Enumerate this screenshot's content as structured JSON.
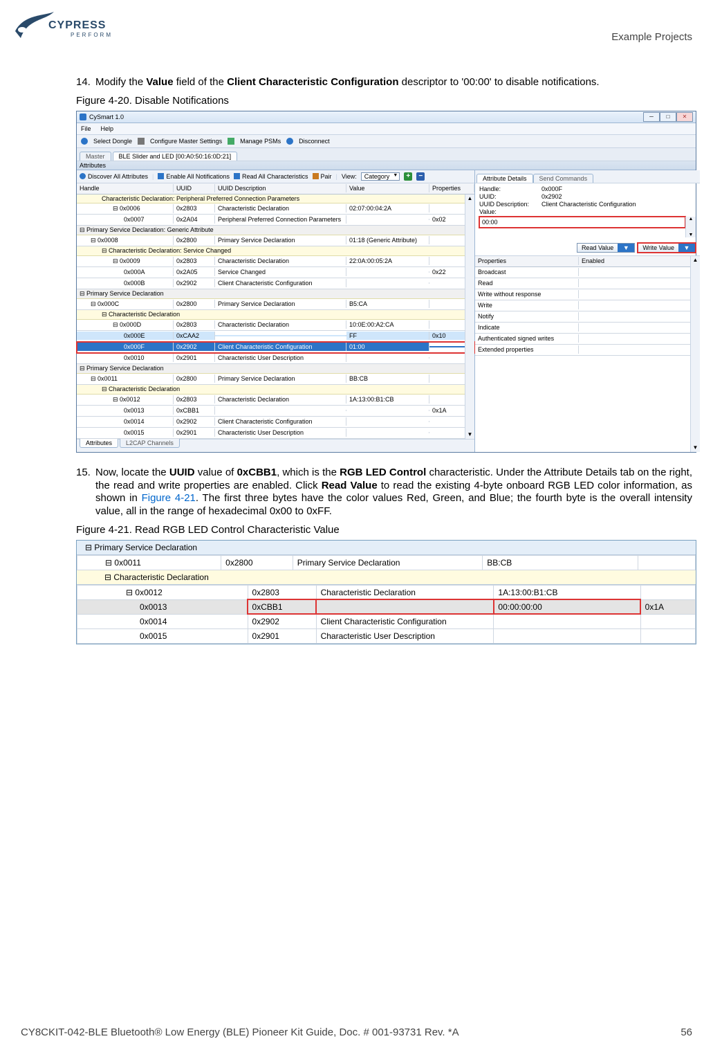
{
  "header": {
    "logo_main": "CYPRESS",
    "logo_sub": "PERFORM",
    "right": "Example Projects"
  },
  "step14": {
    "num": "14.",
    "text_pre": "Modify the ",
    "b1": "Value",
    "text_mid1": " field of the ",
    "b2": "Client Characteristic Configuration",
    "text_post": " descriptor to '00:00' to disable notifications."
  },
  "fig20": {
    "caption": "Figure 4-20.  Disable Notifications",
    "title": "CySmart 1.0",
    "menu": {
      "file": "File",
      "help": "Help"
    },
    "toolbar1": {
      "select_dongle": "Select Dongle",
      "configure": "Configure Master Settings",
      "manage": "Manage PSMs",
      "disconnect": "Disconnect"
    },
    "master_tab": "Master",
    "device_tab": "BLE Slider and LED [00:A0:50:16:0D:21]",
    "attributes_hdr": "Attributes",
    "toolbar2": {
      "discover": "Discover All Attributes",
      "enable": "Enable All Notifications",
      "read": "Read All Characteristics",
      "pair": "Pair",
      "view": "View:",
      "view_val": "Category"
    },
    "grid_headers": {
      "h1": "Handle",
      "h2": "UUID",
      "h3": "UUID Description",
      "h4": "Value",
      "h5": "Properties"
    },
    "groups": {
      "g_cd_ppcp": "Characteristic Declaration: Peripheral Preferred Connection Parameters",
      "g_psd_ga": "Primary Service Declaration: Generic Attribute",
      "g_cd_sc": "Characteristic Declaration: Service Changed",
      "g_psd": "Primary Service Declaration",
      "g_cd": "Characteristic Declaration"
    },
    "rows": [
      {
        "h": "0x0006",
        "u": "0x2803",
        "d": "Characteristic Declaration",
        "v": "02:07:00:04:2A",
        "p": ""
      },
      {
        "h": "0x0007",
        "u": "0x2A04",
        "d": "Peripheral Preferred Connection Parameters",
        "v": "",
        "p": "0x02"
      },
      {
        "h": "0x0008",
        "u": "0x2800",
        "d": "Primary Service Declaration",
        "v": "01:18 (Generic Attribute)",
        "p": ""
      },
      {
        "h": "0x0009",
        "u": "0x2803",
        "d": "Characteristic Declaration",
        "v": "22:0A:00:05:2A",
        "p": ""
      },
      {
        "h": "0x000A",
        "u": "0x2A05",
        "d": "Service Changed",
        "v": "",
        "p": "0x22"
      },
      {
        "h": "0x000B",
        "u": "0x2902",
        "d": "Client Characteristic Configuration",
        "v": "",
        "p": ""
      },
      {
        "h": "0x000C",
        "u": "0x2800",
        "d": "Primary Service Declaration",
        "v": "B5:CA",
        "p": ""
      },
      {
        "h": "0x000D",
        "u": "0x2803",
        "d": "Characteristic Declaration",
        "v": "10:0E:00:A2:CA",
        "p": ""
      },
      {
        "h": "0x000E",
        "u": "0xCAA2",
        "d": "",
        "v": "FF",
        "p": "0x10"
      },
      {
        "h": "0x000F",
        "u": "0x2902",
        "d": "Client Characteristic Configuration",
        "v": "01:00",
        "p": ""
      },
      {
        "h": "0x0010",
        "u": "0x2901",
        "d": "Characteristic User Description",
        "v": "",
        "p": ""
      },
      {
        "h": "0x0011",
        "u": "0x2800",
        "d": "Primary Service Declaration",
        "v": "BB:CB",
        "p": ""
      },
      {
        "h": "0x0012",
        "u": "0x2803",
        "d": "Characteristic Declaration",
        "v": "1A:13:00:B1:CB",
        "p": ""
      },
      {
        "h": "0x0013",
        "u": "0xCBB1",
        "d": "",
        "v": "",
        "p": "0x1A"
      },
      {
        "h": "0x0014",
        "u": "0x2902",
        "d": "Client Characteristic Configuration",
        "v": "",
        "p": ""
      },
      {
        "h": "0x0015",
        "u": "0x2901",
        "d": "Characteristic User Description",
        "v": "",
        "p": ""
      }
    ],
    "bottom_tabs": {
      "attributes": "Attributes",
      "l2cap": "L2CAP Channels"
    },
    "right": {
      "tab_details": "Attribute Details",
      "tab_send": "Send Commands",
      "handle_l": "Handle:",
      "handle_v": "0x000F",
      "uuid_l": "UUID:",
      "uuid_v": "0x2902",
      "uuiddesc_l": "UUID Description:",
      "uuiddesc_v": "Client Characteristic Configuration",
      "value_l": "Value:",
      "value_input": "00:00",
      "read_btn": "Read Value",
      "write_btn": "Write Value",
      "prop_h1": "Properties",
      "prop_h2": "Enabled",
      "props": [
        "Broadcast",
        "Read",
        "Write without response",
        "Write",
        "Notify",
        "Indicate",
        "Authenticated signed writes",
        "Extended properties"
      ]
    }
  },
  "step15": {
    "num": "15.",
    "t1": "Now, locate the ",
    "b1": "UUID",
    "t2": " value of ",
    "b2": "0xCBB1",
    "t3": ", which is the ",
    "b3": "RGB LED Control",
    "t4": " characteristic. Under the Attribute Details tab on the right, the read and write properties are enabled. Click ",
    "b4": "Read Value",
    "t5": " to read the existing 4-byte onboard RGB LED color information, as shown in ",
    "link": "Figure 4-21",
    "t6": ". The first three bytes have the color values Red, Green, and Blue; the fourth byte is the overall intensity value, all in the range of hexadecimal 0x00 to 0xFF."
  },
  "fig21": {
    "caption": "Figure 4-21.  Read RGB LED Control Characteristic Value",
    "grp0": "Primary Service Declaration",
    "grp1": "Characteristic Declaration",
    "rows": [
      {
        "h": "0x0011",
        "u": "0x2800",
        "d": "Primary Service Declaration",
        "v": "BB:CB",
        "p": ""
      },
      {
        "h": "0x0012",
        "u": "0x2803",
        "d": "Characteristic Declaration",
        "v": "1A:13:00:B1:CB",
        "p": ""
      },
      {
        "h": "0x0013",
        "u": "0xCBB1",
        "d": "",
        "v": "00:00:00:00",
        "p": "0x1A"
      },
      {
        "h": "0x0014",
        "u": "0x2902",
        "d": "Client Characteristic Configuration",
        "v": "",
        "p": ""
      },
      {
        "h": "0x0015",
        "u": "0x2901",
        "d": "Characteristic User Description",
        "v": "",
        "p": ""
      }
    ]
  },
  "footer": {
    "left": "CY8CKIT-042-BLE Bluetooth® Low Energy (BLE) Pioneer Kit Guide, Doc. # 001-93731 Rev. *A",
    "right": "56"
  }
}
